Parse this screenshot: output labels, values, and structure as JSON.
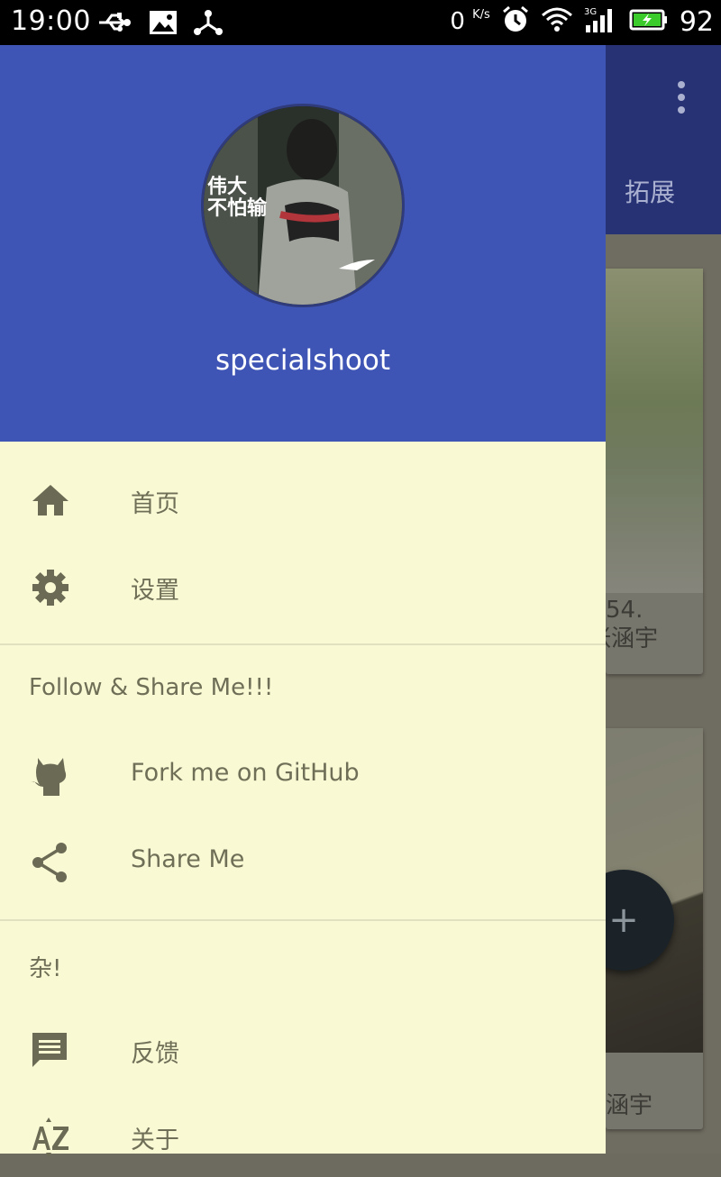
{
  "status_bar": {
    "time": "19:00",
    "speed_value": "0",
    "speed_unit": "K/s",
    "battery": "92",
    "icons": [
      "usb-icon",
      "image-icon",
      "share-hub-icon",
      "alarm-icon",
      "wifi-icon",
      "signal-3g-icon",
      "battery-charging-icon"
    ]
  },
  "background_app": {
    "tab_label": "拓展",
    "card1_caption_line1": "54.",
    "card1_caption_line2": "张涵宇",
    "card2_caption": "涵宇",
    "fab_icon": "add-icon"
  },
  "drawer": {
    "header_color": "#3f55b5",
    "username": "specialshoot",
    "avatar_text_1": "伟大",
    "avatar_text_2": "不怕输",
    "menu_primary": [
      {
        "label": "首页",
        "icon": "home-icon"
      },
      {
        "label": "设置",
        "icon": "gear-icon"
      }
    ],
    "section_follow": {
      "title": "Follow & Share Me!!!",
      "items": [
        {
          "label": "Fork me on GitHub",
          "icon": "github-icon"
        },
        {
          "label": "Share Me",
          "icon": "share-icon"
        }
      ]
    },
    "section_misc": {
      "title": "杂!",
      "items": [
        {
          "label": "反馈",
          "icon": "feedback-icon"
        },
        {
          "label": "关于",
          "icon": "sort-az-icon"
        }
      ]
    }
  }
}
